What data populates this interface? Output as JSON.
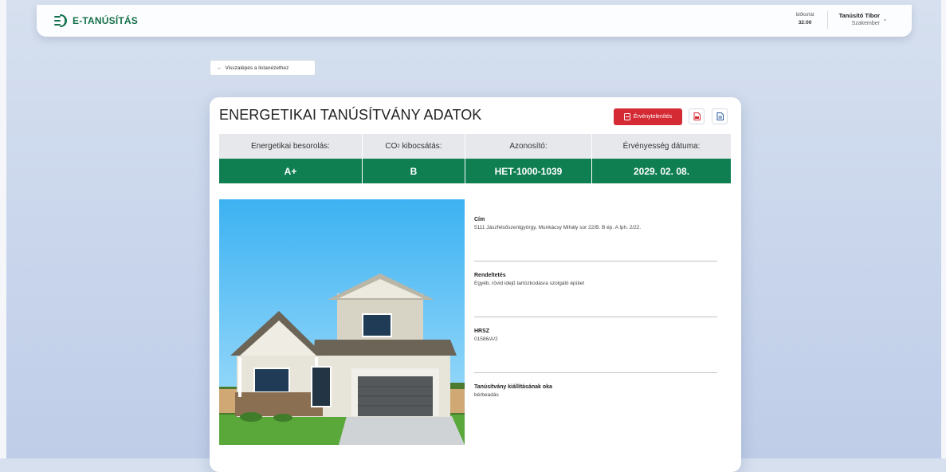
{
  "app": {
    "name": "E-TANÚSÍTÁS",
    "brand_color": "#14704a",
    "accent_color": "#0f7f52",
    "danger_color": "#d42a34"
  },
  "header": {
    "timer_label": "Időkorlát",
    "timer_value": "32:00",
    "user_name": "Tanúsító Tibor",
    "user_role": "Szakember",
    "chevron_icon": "chevron-down-icon"
  },
  "nav": {
    "back_label": "Visszalépés a listanézethez",
    "back_icon": "arrow-left-icon"
  },
  "card": {
    "title": "ENERGETIKAI TANÚSÍTVÁNY ADATOK",
    "invalidate_label": "Érvénytelenítés",
    "pdf_icon": "pdf-icon",
    "doc_icon": "document-icon",
    "stats": {
      "headers": [
        "Energetikai besorolás:",
        "CO",
        "Azonosító:",
        "Érvényesség dátuma:"
      ],
      "co2_subscript": "2",
      "co2_suffix": " kibocsátás:",
      "values": [
        "A+",
        "B",
        "HET-1000-1039",
        "2029. 02. 08."
      ]
    },
    "details": [
      {
        "label": "Cím",
        "value": "5111 Jászfelsőszentgyörgy, Munkácsy Mihály sor 22/B. B ép. A lph. 2/22."
      },
      {
        "label": "Rendeltetés",
        "value": "Egyéb, rövid idejű tartózkodásra szolgáló épület"
      },
      {
        "label": "HRSZ",
        "value": "01586/A/2"
      },
      {
        "label": "Tanúsítvány kiállításának oka",
        "value": "bérbeadás"
      }
    ]
  }
}
